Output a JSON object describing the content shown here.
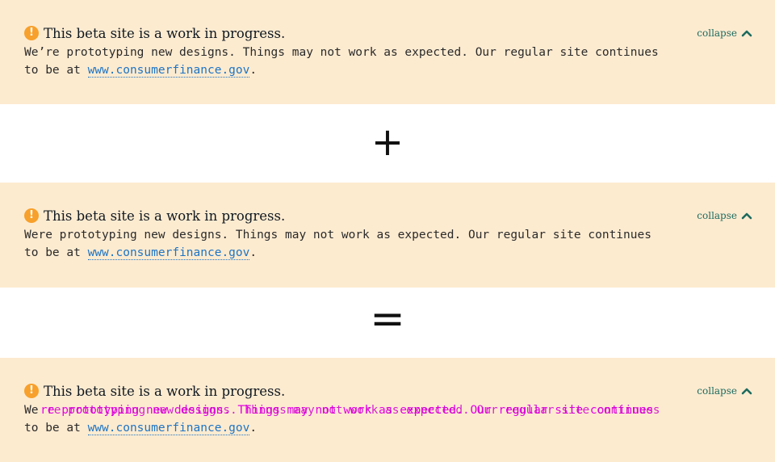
{
  "banner_top": {
    "title": "This beta site is a work in progress.",
    "collapse_label": "collapse",
    "body_line1": "We’re prototyping new designs. Things may not work as expected. Our regular site continues",
    "body_line2_prefix": "to be at ",
    "link_text": "www.consumerfinance.gov",
    "body_line2_suffix": "."
  },
  "operator_plus": "+",
  "banner_middle": {
    "title": "This beta site is a work in progress.",
    "collapse_label": "collapse",
    "body_line1": "Were prototyping new designs. Things may not work as expected. Our regular site continues",
    "body_line2_prefix": "to be at ",
    "link_text": "www.consumerfinance.gov",
    "body_line2_suffix": "."
  },
  "operator_equals": "=",
  "banner_result": {
    "title": "This beta site is a work in progress.",
    "collapse_label": "collapse",
    "body_line1": "We",
    "overlay_text": "re prototyping new designs. Things may not work as expected. Our regular site continues",
    "body_line2_prefix": "to be at ",
    "link_text": "www.consumerfinance.gov",
    "body_line2_suffix": "."
  },
  "colors": {
    "banner_bg": "#fdebd0",
    "warning_icon": "#f7a02b",
    "link": "#1d74c4",
    "collapse": "#1d6b5f",
    "diff_overlay": "#e600e6"
  },
  "icons": {
    "warning": "exclamation-circle-icon",
    "collapse": "chevron-up-icon"
  }
}
